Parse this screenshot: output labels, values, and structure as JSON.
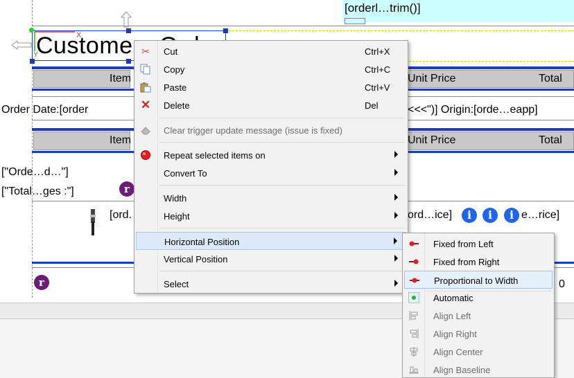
{
  "report": {
    "expression_top": "[orderl…trim()]",
    "title_text": "Custome",
    "title_tail": "Ord",
    "header1": {
      "item_label": "Item",
      "unit_price_label": "Unit Price",
      "total_label": "Total"
    },
    "order_row": {
      "left_text": "Order Date:[order",
      "right_text": "<<<\")]  Origin:[orde…eapp]"
    },
    "header2": {
      "item_label": "Item",
      "unit_price_label": "Unit Price",
      "total_label": "Total"
    },
    "group_text": "[\"Orde…d…\"]",
    "total_text": "[\"Total…ges :\"]",
    "detail_left": "[ord.",
    "detail_right": "ord…ice]",
    "detail_right2": "e…rice]",
    "footer_value": "0",
    "r_glyph": "r",
    "i_glyph": "i",
    "accent_blue": "#1f3ab6",
    "cyan_bg": "#ccffff"
  },
  "context_menu": {
    "items": [
      {
        "label": "Cut",
        "shortcut": "Ctrl+X",
        "icon": "scissors-icon"
      },
      {
        "label": "Copy",
        "shortcut": "Ctrl+C",
        "icon": "copy-icon"
      },
      {
        "label": "Paste",
        "shortcut": "Ctrl+V",
        "icon": "paste-icon"
      },
      {
        "label": "Delete",
        "shortcut": "Del",
        "icon": "delete-x-icon"
      },
      {
        "label": "Clear trigger update message (issue is fixed)",
        "icon": "eraser-icon",
        "disabled": true
      },
      {
        "label": "Repeat selected items on",
        "icon": "red-ball-icon",
        "submenu": true
      },
      {
        "label": "Convert To",
        "submenu": true
      },
      {
        "label": "Width",
        "submenu": true
      },
      {
        "label": "Height",
        "submenu": true
      },
      {
        "label": "Horizontal Position",
        "submenu": true,
        "highlighted": true
      },
      {
        "label": "Vertical Position",
        "submenu": true
      },
      {
        "label": "Select",
        "submenu": true
      }
    ]
  },
  "submenu": {
    "items": [
      {
        "label": "Fixed from Left",
        "icon": "pin-left-icon"
      },
      {
        "label": "Fixed from Right",
        "icon": "pin-right-icon"
      },
      {
        "label": "Proportional to Width",
        "icon": "proportional-icon",
        "highlighted": true
      },
      {
        "label": "Automatic",
        "icon": "green-dot-icon"
      },
      {
        "label": "Align Left",
        "icon": "align-left-icon",
        "disabled": true
      },
      {
        "label": "Align Right",
        "icon": "align-right-icon",
        "disabled": true
      },
      {
        "label": "Align Center",
        "icon": "align-center-icon",
        "disabled": true
      },
      {
        "label": "Align Baseline",
        "icon": "align-baseline-icon",
        "disabled": true
      }
    ]
  }
}
